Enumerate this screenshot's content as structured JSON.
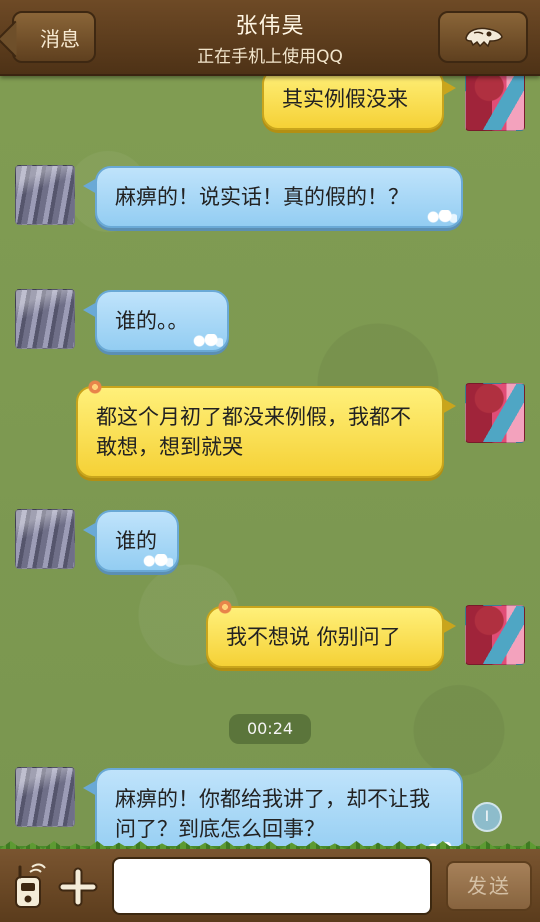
{
  "header": {
    "back_label": "消息",
    "contact_name": "张伟昊",
    "status": "正在手机上使用QQ"
  },
  "messages": [
    {
      "sender": "self",
      "text": "其实例假没来"
    },
    {
      "sender": "friend",
      "text": "麻痹的！说实话！真的假的！？"
    },
    {
      "sender": "friend",
      "text": "谁的。。"
    },
    {
      "sender": "self",
      "text": "都这个月初了都没来例假，我都不敢想，想到就哭"
    },
    {
      "sender": "friend",
      "text": "谁的"
    },
    {
      "sender": "self",
      "text": "我不想说 你别问了"
    },
    {
      "sender": "friend",
      "text": "麻痹的！你都给我讲了，却不让我问了？到底怎么回事？"
    }
  ],
  "timestamp": "00:24",
  "scroll_indicator": "I",
  "input": {
    "value": "",
    "placeholder": "",
    "send_label": "发送"
  },
  "icons": {
    "profile": "dinosaur-skull-icon",
    "voice": "walkie-talkie-icon",
    "plus": "plus-icon"
  }
}
